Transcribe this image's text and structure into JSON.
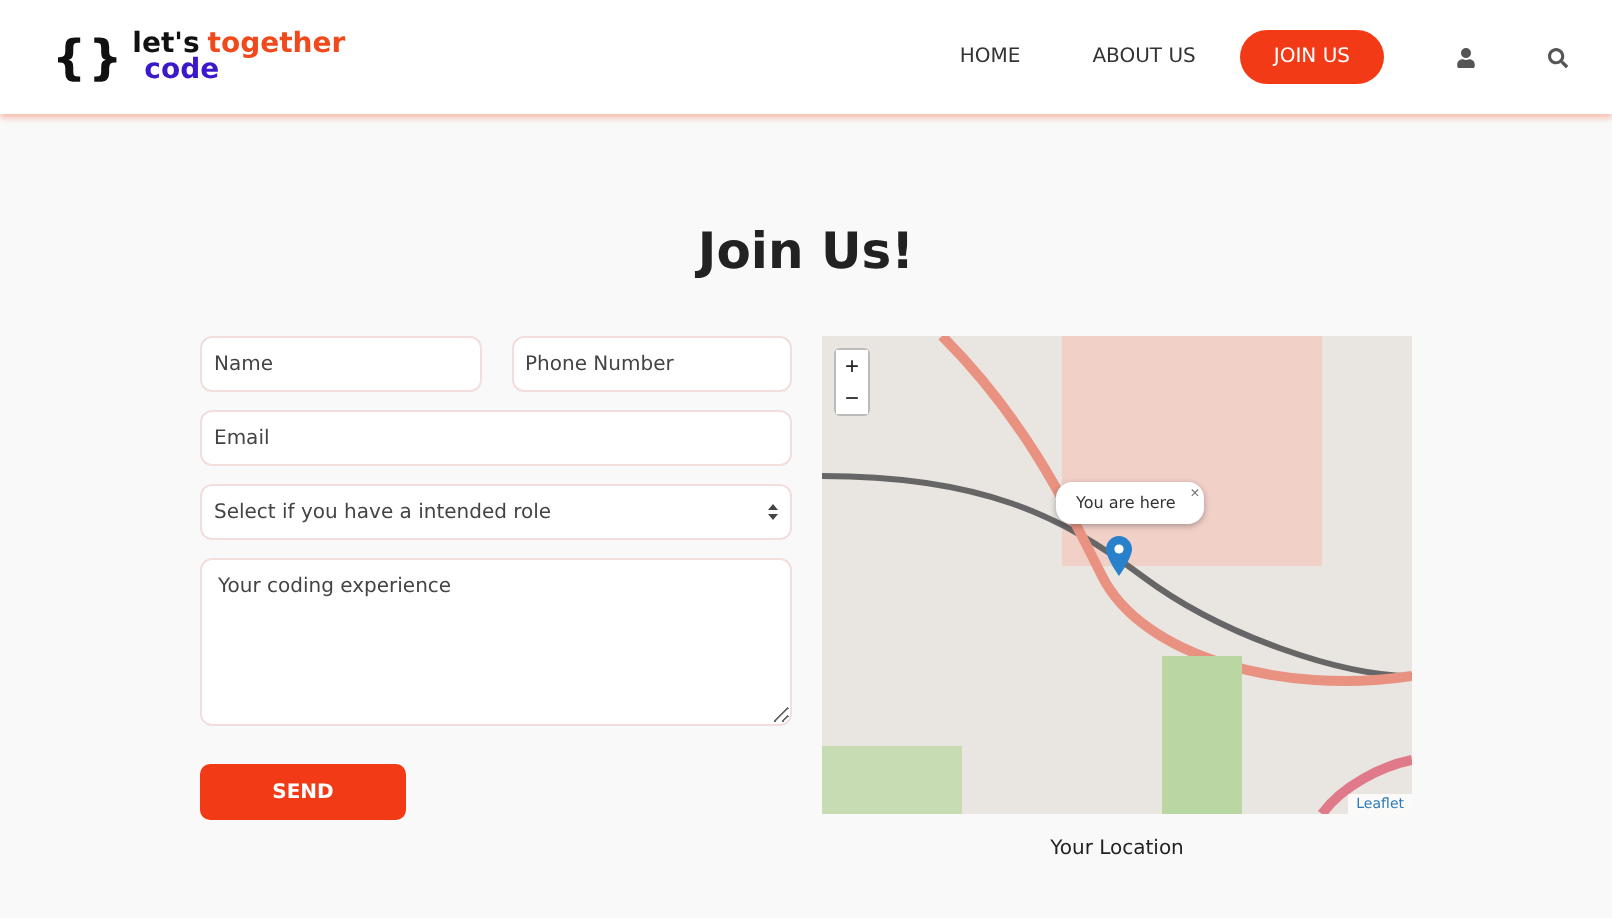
{
  "logo": {
    "brace": "{}",
    "word_1": "let's",
    "word_2": "together",
    "word_3": "code"
  },
  "nav": [
    {
      "label": "HOME",
      "kind": "link"
    },
    {
      "label": "ABOUT US",
      "kind": "link"
    },
    {
      "label": "JOIN US",
      "kind": "cta"
    }
  ],
  "page_title": "Join Us!",
  "form": {
    "name": {
      "placeholder": "Name"
    },
    "phone": {
      "placeholder": "Phone Number"
    },
    "email": {
      "placeholder": "Email"
    },
    "role": {
      "value": "Select if you have a intended role"
    },
    "experience": {
      "placeholder": "Your coding experience"
    },
    "submit": "SEND"
  },
  "map": {
    "zoom_in": "+",
    "zoom_out": "−",
    "popup": "You are here",
    "popup_close": "×",
    "attribution": "Leaflet",
    "caption": "Your Location"
  }
}
